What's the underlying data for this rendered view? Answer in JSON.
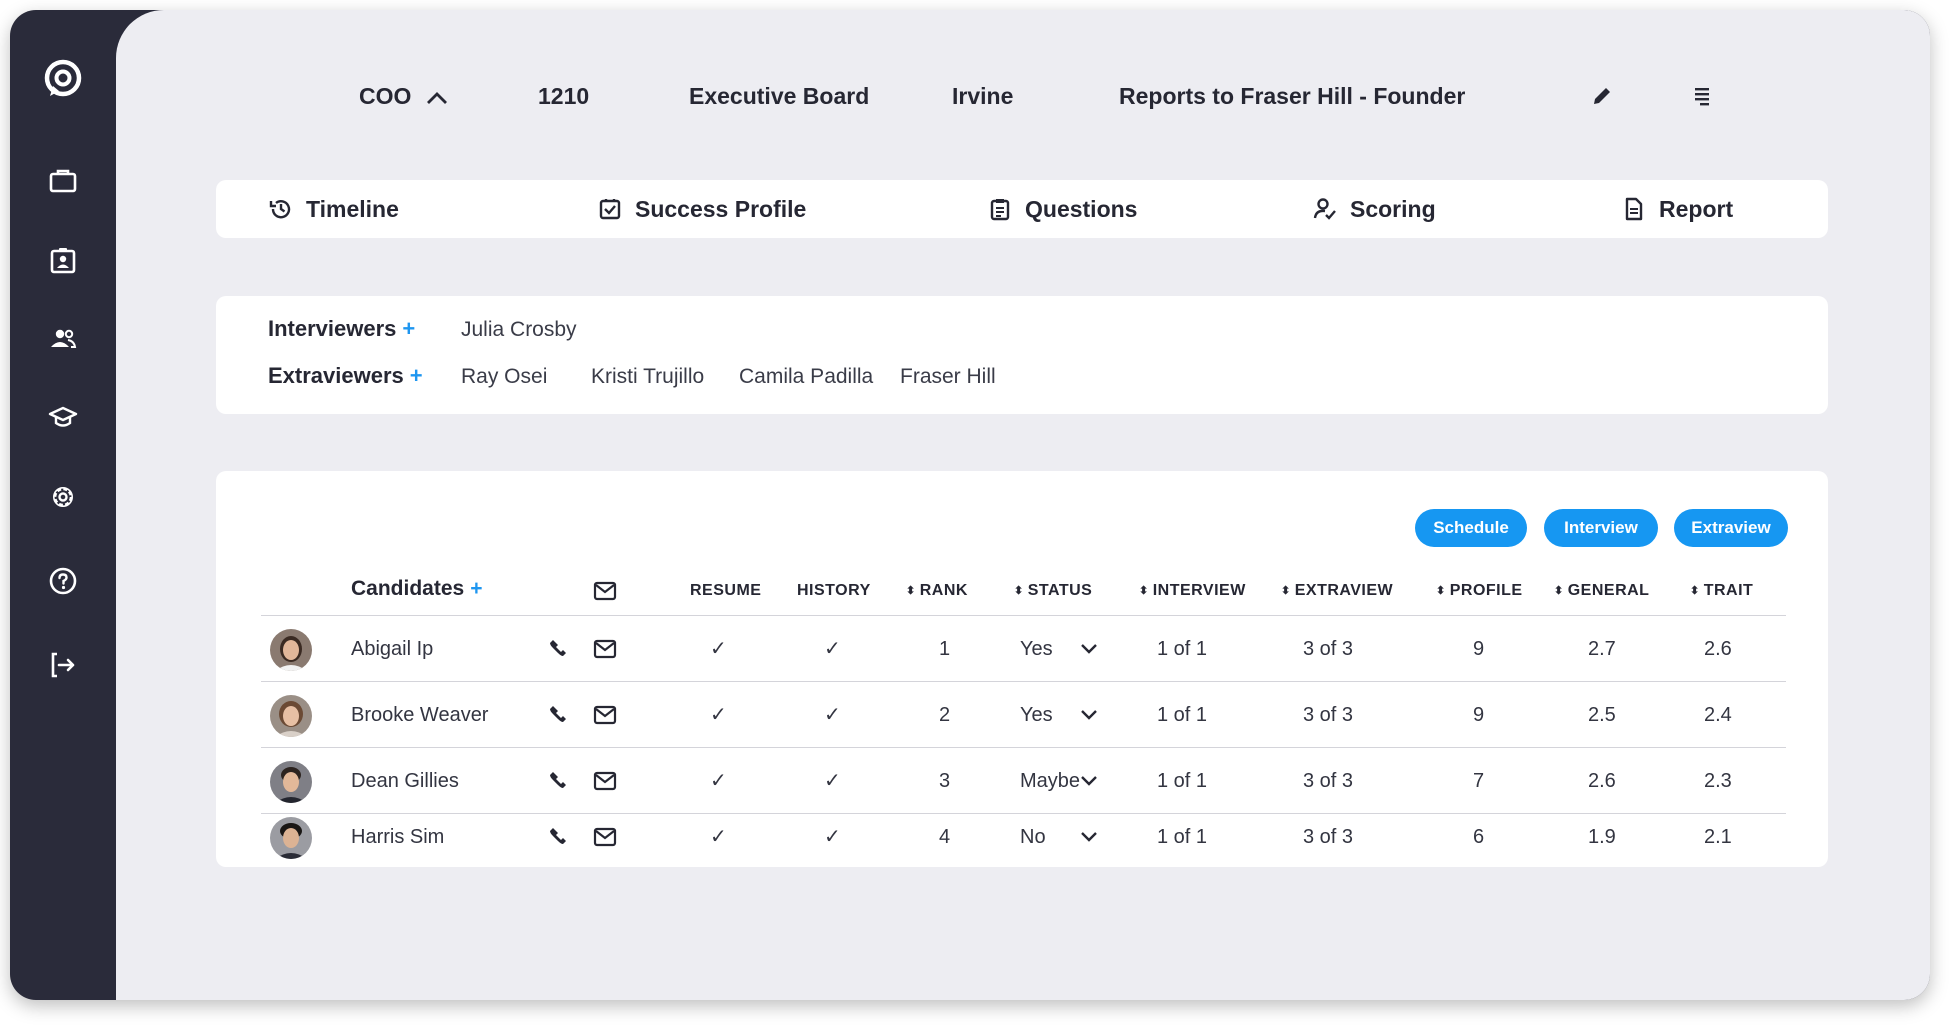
{
  "sidebar": {
    "items": [
      {
        "icon": "chat-logo-icon"
      },
      {
        "icon": "briefcase-icon"
      },
      {
        "icon": "id-badge-icon"
      },
      {
        "icon": "users-icon"
      },
      {
        "icon": "graduation-cap-icon"
      },
      {
        "icon": "gear-icon"
      },
      {
        "icon": "help-icon"
      },
      {
        "icon": "logout-icon"
      }
    ]
  },
  "header": {
    "role": "COO",
    "code": "1210",
    "department": "Executive Board",
    "location": "Irvine",
    "reports_to": "Reports to Fraser Hill - Founder"
  },
  "tabs": [
    {
      "label": "Timeline",
      "icon": "history-icon"
    },
    {
      "label": "Success Profile",
      "icon": "checkbox-icon"
    },
    {
      "label": "Questions",
      "icon": "clipboard-icon"
    },
    {
      "label": "Scoring",
      "icon": "user-check-icon"
    },
    {
      "label": "Report",
      "icon": "document-icon"
    }
  ],
  "panel": {
    "interviewers_label": "Interviewers",
    "extraviewers_label": "Extraviewers",
    "plus": "+",
    "interviewers": [
      "Julia Crosby"
    ],
    "extraviewers": [
      "Ray Osei",
      "Kristi Trujillo",
      "Camila Padilla",
      "Fraser Hill"
    ]
  },
  "actions": {
    "schedule": "Schedule",
    "interview": "Interview",
    "extraview": "Extraview"
  },
  "table": {
    "candidates_label": "Candidates",
    "sort_glyph": "⬍",
    "columns": {
      "resume": "RESUME",
      "history": "HISTORY",
      "rank": "RANK",
      "status": "STATUS",
      "interview": "INTERVIEW",
      "extraview": "EXTRAVIEW",
      "profile": "PROFILE",
      "general": "GENERAL",
      "trait": "TRAIT"
    },
    "check": "✓",
    "rows": [
      {
        "name": "Abigail Ip",
        "rank": "1",
        "status": "Yes",
        "interview": "1 of 1",
        "extraview": "3 of 3",
        "profile": "9",
        "general": "2.7",
        "trait": "2.6"
      },
      {
        "name": "Brooke Weaver",
        "rank": "2",
        "status": "Yes",
        "interview": "1 of 1",
        "extraview": "3 of 3",
        "profile": "9",
        "general": "2.5",
        "trait": "2.4"
      },
      {
        "name": "Dean Gillies",
        "rank": "3",
        "status": "Maybe",
        "interview": "1 of 1",
        "extraview": "3 of 3",
        "profile": "7",
        "general": "2.6",
        "trait": "2.3"
      },
      {
        "name": "Harris Sim",
        "rank": "4",
        "status": "No",
        "interview": "1 of 1",
        "extraview": "3 of 3",
        "profile": "6",
        "general": "1.9",
        "trait": "2.1"
      }
    ]
  },
  "colors": {
    "sidebar": "#2a2b3a",
    "background": "#ededf2",
    "accent": "#1697f2",
    "card": "#ffffff"
  }
}
